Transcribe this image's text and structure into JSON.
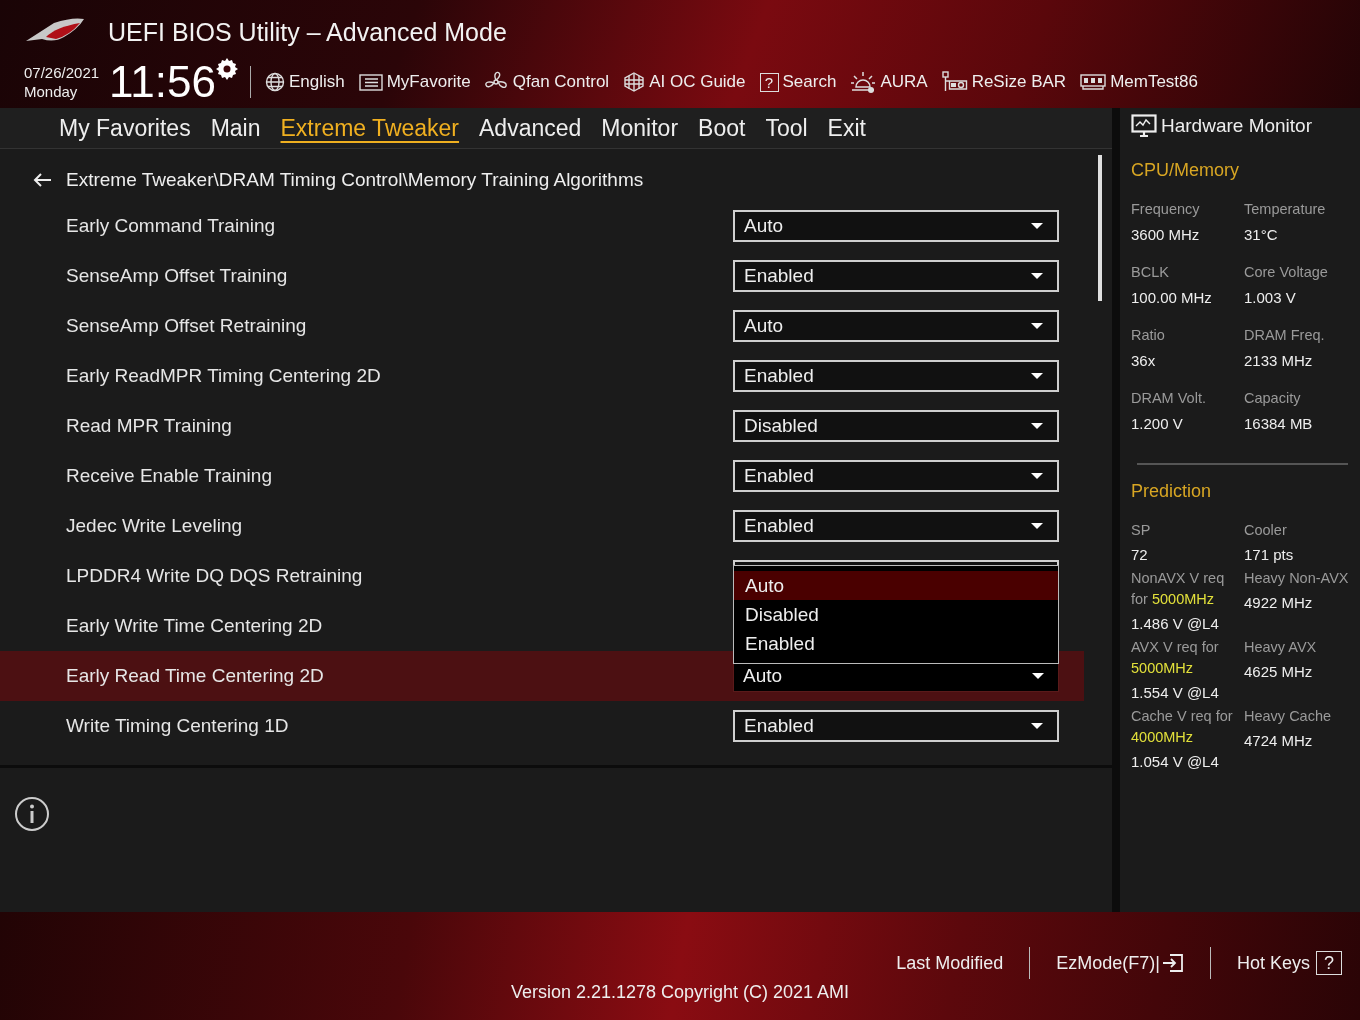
{
  "header": {
    "title": "UEFI BIOS Utility – Advanced Mode",
    "date": "07/26/2021",
    "day": "Monday",
    "time": "11:56",
    "tools": [
      {
        "kind": "globe",
        "label": "English"
      },
      {
        "kind": "favorite",
        "label": "MyFavorite"
      },
      {
        "kind": "fan",
        "label": "Qfan Control"
      },
      {
        "kind": "chip",
        "label": "AI OC Guide"
      },
      {
        "kind": "search",
        "label": "Search",
        "glyph": "?"
      },
      {
        "kind": "aura",
        "label": "AURA"
      },
      {
        "kind": "resize",
        "label": "ReSize BAR"
      },
      {
        "kind": "memory",
        "label": "MemTest86"
      }
    ]
  },
  "tabs": [
    {
      "label": "My Favorites",
      "selected": false
    },
    {
      "label": "Main",
      "selected": false
    },
    {
      "label": "Extreme Tweaker",
      "selected": true
    },
    {
      "label": "Advanced",
      "selected": false
    },
    {
      "label": "Monitor",
      "selected": false
    },
    {
      "label": "Boot",
      "selected": false
    },
    {
      "label": "Tool",
      "selected": false
    },
    {
      "label": "Exit",
      "selected": false
    }
  ],
  "breadcrumb": "Extreme Tweaker\\DRAM Timing Control\\Memory Training Algorithms",
  "settings": [
    {
      "kind": "select",
      "label": "Early Command Training",
      "value": "Auto",
      "highlighted": false
    },
    {
      "kind": "select",
      "label": "SenseAmp Offset Training",
      "value": "Enabled",
      "highlighted": false
    },
    {
      "kind": "select",
      "label": "SenseAmp Offset Retraining",
      "value": "Auto",
      "highlighted": false
    },
    {
      "kind": "select",
      "label": "Early ReadMPR Timing Centering 2D",
      "value": "Enabled",
      "highlighted": false
    },
    {
      "kind": "select",
      "label": "Read MPR Training",
      "value": "Disabled",
      "highlighted": false
    },
    {
      "kind": "select",
      "label": "Receive Enable Training",
      "value": "Enabled",
      "highlighted": false
    },
    {
      "kind": "select",
      "label": "Jedec Write Leveling",
      "value": "Enabled",
      "highlighted": false
    },
    {
      "kind": "open-select",
      "label": "LPDDR4 Write DQ DQS Retraining",
      "highlighted": false,
      "options": [
        {
          "label": "Auto",
          "selected": true
        },
        {
          "label": "Disabled",
          "selected": false
        },
        {
          "label": "Enabled",
          "selected": false
        }
      ]
    },
    {
      "kind": "covered",
      "label": "Early Write Time Centering 2D",
      "highlighted": false
    },
    {
      "kind": "select",
      "label": "Early Read Time Centering 2D",
      "value": "Auto",
      "highlighted": true
    },
    {
      "kind": "select",
      "label": "Write Timing Centering 1D",
      "value": "Enabled",
      "highlighted": false
    }
  ],
  "hardware_monitor": {
    "title": "Hardware Monitor",
    "sections": [
      {
        "title": "CPU/Memory",
        "items": [
          {
            "label": "Frequency",
            "value": "3600 MHz"
          },
          {
            "label": "Temperature",
            "value": "31°C"
          },
          {
            "label": "BCLK",
            "value": "100.00 MHz"
          },
          {
            "label": "Core Voltage",
            "value": "1.003 V"
          },
          {
            "label": "Ratio",
            "value": "36x"
          },
          {
            "label": "DRAM Freq.",
            "value": "2133 MHz"
          },
          {
            "label": "DRAM Volt.",
            "value": "1.200 V"
          },
          {
            "label": "Capacity",
            "value": "16384 MB"
          }
        ]
      },
      {
        "title": "Prediction",
        "items": [
          {
            "label": "SP",
            "value": "72"
          },
          {
            "label": "Cooler",
            "value": "171 pts"
          },
          {
            "label": "NonAVX V req for **5000MHz**",
            "value": "1.486 V @L4"
          },
          {
            "label": "Heavy Non-AVX",
            "value": "4922 MHz"
          },
          {
            "label": "AVX V req for **5000MHz**",
            "value": "1.554 V @L4"
          },
          {
            "label": "Heavy AVX",
            "value": "4625 MHz"
          },
          {
            "label": "Cache V req for **4000MHz**",
            "value": "1.054 V @L4"
          },
          {
            "label": "Heavy Cache",
            "value": "4724 MHz"
          }
        ]
      }
    ]
  },
  "footer": {
    "links": [
      {
        "kind": "text",
        "label": "Last Modified"
      },
      {
        "kind": "exit",
        "label": "EzMode(F7)|"
      },
      {
        "kind": "help",
        "label": "Hot Keys",
        "glyph": "?"
      }
    ],
    "version": "Version 2.21.1278 Copyright (C) 2021 AMI"
  }
}
